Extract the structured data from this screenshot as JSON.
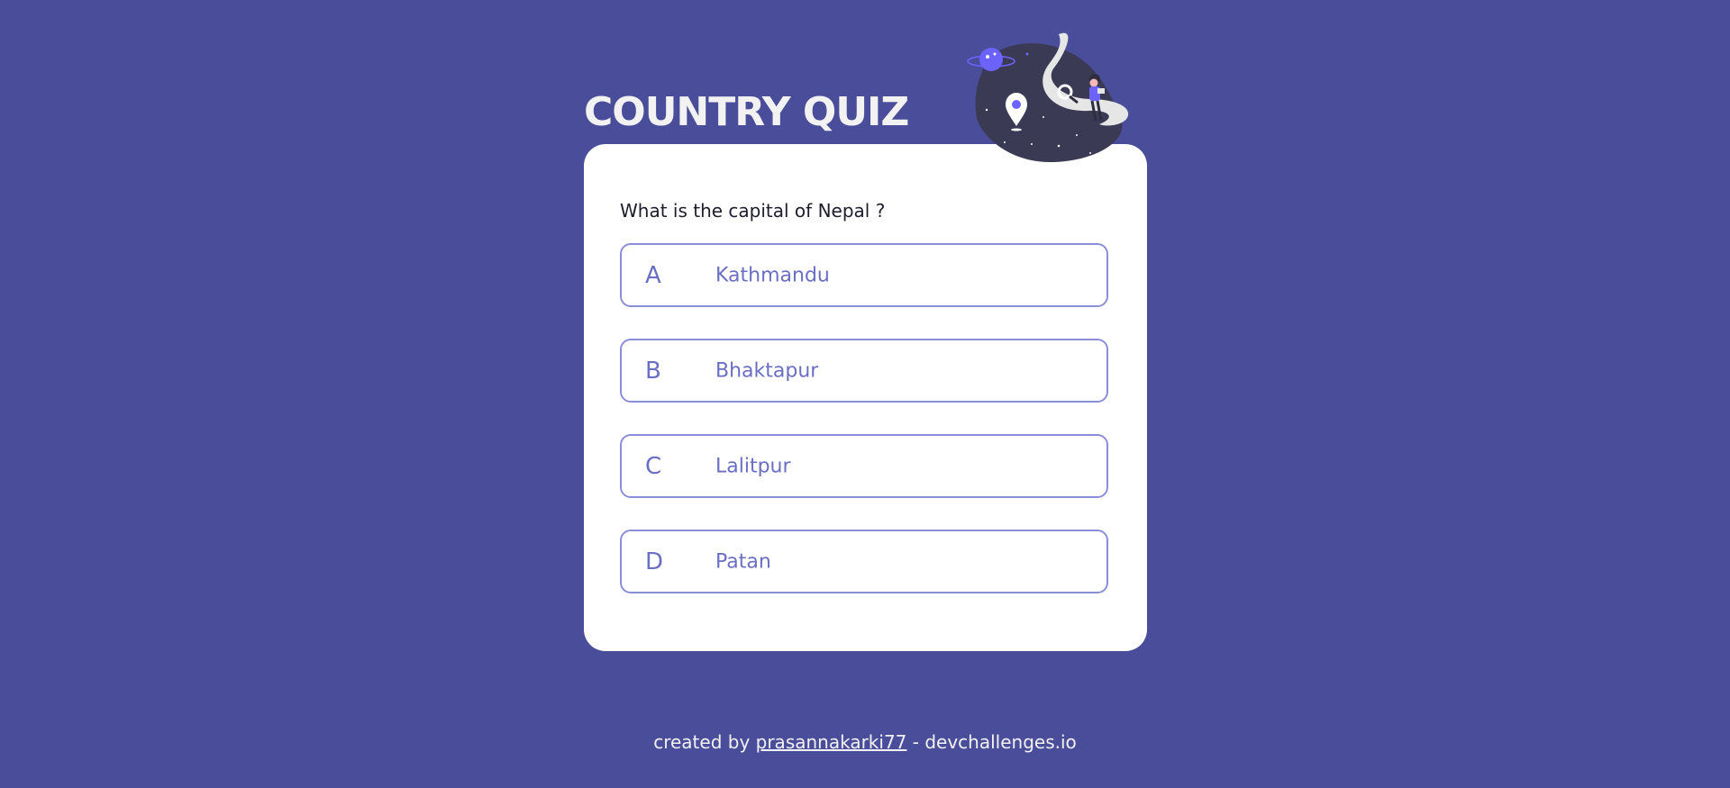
{
  "header": {
    "title": "COUNTRY QUIZ"
  },
  "quiz": {
    "question": "What is the capital of Nepal ?",
    "options": [
      {
        "letter": "A",
        "text": "Kathmandu"
      },
      {
        "letter": "B",
        "text": "Bhaktapur"
      },
      {
        "letter": "C",
        "text": "Lalitpur"
      },
      {
        "letter": "D",
        "text": "Patan"
      }
    ]
  },
  "footer": {
    "prefix": "created by",
    "author_link": "prasannakarki77",
    "suffix": "- devchallenges.io"
  },
  "colors": {
    "background": "#4a4d9a",
    "card": "#ffffff",
    "option_accent": "#6b6fc4",
    "option_border": "#8b8fd9"
  },
  "icons": {
    "illustration": "adventure-illustration"
  }
}
